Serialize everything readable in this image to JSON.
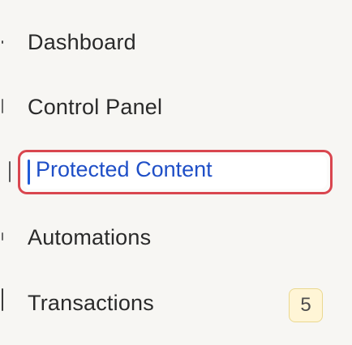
{
  "sidebar": {
    "items": [
      {
        "label": "Dashboard"
      },
      {
        "label": "Control Panel"
      },
      {
        "label": "Protected Content",
        "focused": true
      },
      {
        "label": "Automations"
      },
      {
        "label": "Transactions",
        "badge": "5"
      }
    ]
  },
  "colors": {
    "focus_ring": "#d9464f",
    "active_text": "#1f4fc7",
    "badge_bg": "#fff5d6",
    "page_bg": "#f7f6f3"
  }
}
